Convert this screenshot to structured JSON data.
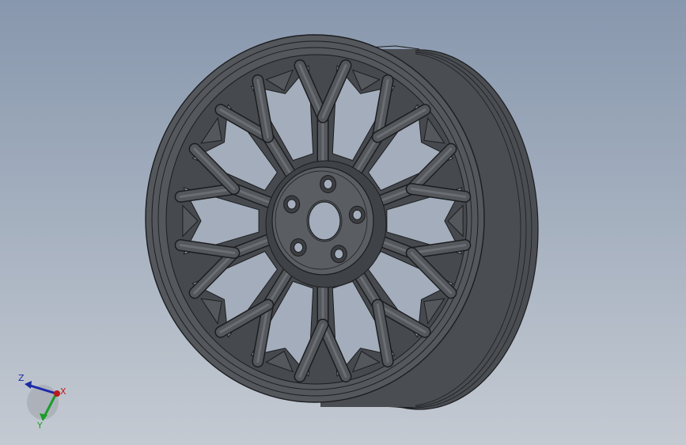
{
  "viewport": {
    "background_top": "#8797ad",
    "background_bottom": "#c4cad2",
    "model_fill": "#54575c",
    "model_dark": "#3c3e42",
    "model_light": "#6b6e73",
    "edge_color": "#1c1d1f",
    "window_color": "#a3adbb"
  },
  "model": {
    "spoke_count": 10,
    "lug_holes": 5
  },
  "triad": {
    "z_label": "Z",
    "x_label": "X",
    "y_label": "Y",
    "z_color": "#1b2aa8",
    "x_color": "#c01818",
    "y_color": "#15a024"
  }
}
